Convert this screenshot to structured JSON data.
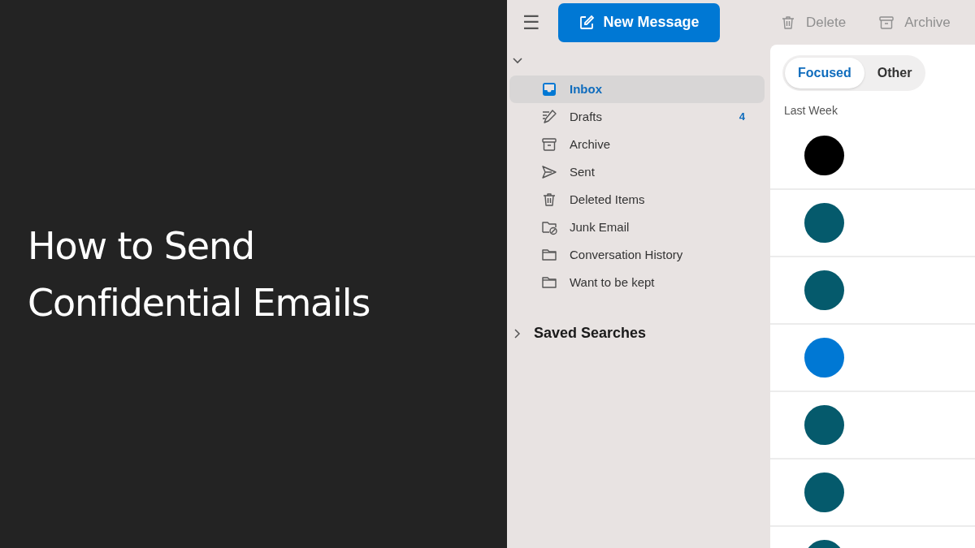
{
  "headline": "How to Send Confidential Emails",
  "toolbar": {
    "menu": "☰",
    "new_message": "New Message",
    "actions": [
      {
        "kind": "delete",
        "label": "Delete"
      },
      {
        "kind": "archive",
        "label": "Archive"
      }
    ]
  },
  "sidebar": {
    "account_expanded": true,
    "folders": [
      {
        "kind": "inbox",
        "label": "Inbox",
        "selected": true
      },
      {
        "kind": "drafts",
        "label": "Drafts",
        "selected": false,
        "count": "4"
      },
      {
        "kind": "archive",
        "label": "Archive",
        "selected": false
      },
      {
        "kind": "sent",
        "label": "Sent",
        "selected": false
      },
      {
        "kind": "trash",
        "label": "Deleted Items",
        "selected": false
      },
      {
        "kind": "junk",
        "label": "Junk Email",
        "selected": false
      },
      {
        "kind": "folder",
        "label": "Conversation History",
        "selected": false
      },
      {
        "kind": "folder",
        "label": "Want to be kept",
        "selected": false
      }
    ],
    "saved_searches": {
      "label": "Saved Searches",
      "expanded": false
    }
  },
  "message_list": {
    "tabs": [
      {
        "label": "Focused",
        "selected": true
      },
      {
        "label": "Other",
        "selected": false
      }
    ],
    "group": "Last Week",
    "messages": [
      {
        "color": "#000000"
      },
      {
        "color": "#055a6c"
      },
      {
        "color": "#055a6c"
      },
      {
        "color": "#0078d4"
      },
      {
        "color": "#055a6c"
      },
      {
        "color": "#055a6c"
      },
      {
        "color": "#055a6c"
      }
    ]
  }
}
